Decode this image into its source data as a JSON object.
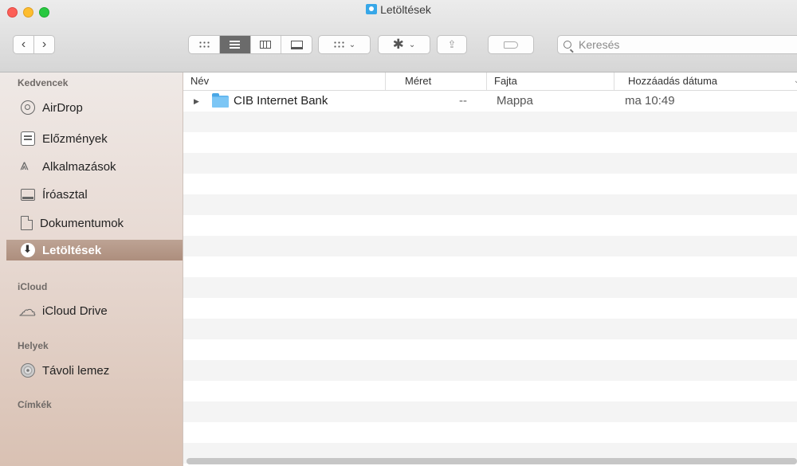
{
  "window": {
    "title": "Letöltések"
  },
  "toolbar": {
    "back_glyph": "‹",
    "forward_glyph": "›",
    "search_placeholder": "Keresés",
    "search_value": ""
  },
  "sidebar": {
    "sections": [
      {
        "label": "Kedvencek"
      },
      {
        "label": "iCloud"
      },
      {
        "label": "Helyek"
      },
      {
        "label": "Címkék"
      }
    ],
    "favorites": [
      {
        "label": "AirDrop",
        "icon": "airdrop-icon"
      },
      {
        "label": "Előzmények",
        "icon": "recents-icon"
      },
      {
        "label": "Alkalmazások",
        "icon": "applications-icon"
      },
      {
        "label": "Íróasztal",
        "icon": "desktop-icon"
      },
      {
        "label": "Dokumentumok",
        "icon": "documents-icon"
      },
      {
        "label": "Letöltések",
        "icon": "downloads-icon",
        "selected": true
      }
    ],
    "icloud": [
      {
        "label": "iCloud Drive",
        "icon": "cloud-icon"
      }
    ],
    "places": [
      {
        "label": "Távoli lemez",
        "icon": "disk-icon"
      }
    ]
  },
  "table": {
    "columns": [
      "Név",
      "Méret",
      "Fajta",
      "Hozzáadás dátuma"
    ],
    "rows": [
      {
        "name": "CIB Internet Bank",
        "size": "--",
        "kind": "Mappa",
        "date_added": "ma 10:49"
      }
    ]
  },
  "colors": {
    "selection": "#b29585",
    "folder": "#64b8f0",
    "close": "#fc5f57",
    "minimize": "#fdbd2e",
    "zoom": "#28c840"
  }
}
